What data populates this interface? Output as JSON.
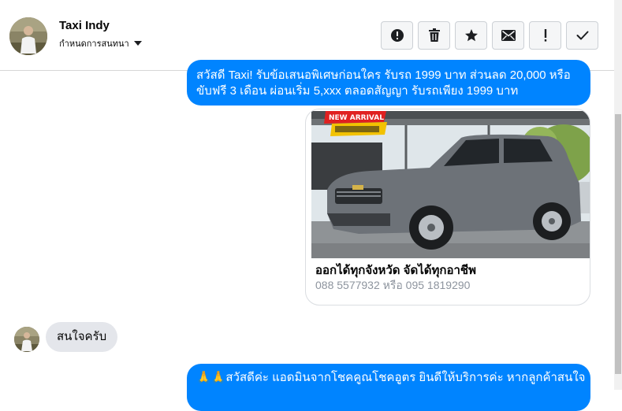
{
  "header": {
    "contact_name": "Taxi Indy",
    "conversation_settings_label": "กำหนดการสนทนา",
    "toolbar": [
      {
        "name": "mark-spam-button",
        "icon": "alert-circle-icon"
      },
      {
        "name": "delete-button",
        "icon": "trash-icon"
      },
      {
        "name": "star-button",
        "icon": "star-icon"
      },
      {
        "name": "mark-unread-button",
        "icon": "envelope-icon"
      },
      {
        "name": "mark-important-button",
        "icon": "exclamation-icon"
      },
      {
        "name": "mark-done-button",
        "icon": "checkmark-icon"
      }
    ]
  },
  "conversation": {
    "messages": [
      {
        "direction": "outgoing",
        "lines": [
          "สวัสดี Taxi! รับข้อเสนอพิเศษก่อนใคร รับรถ 1999 บาท ส่วนลด 20,000 หรือ",
          "ขับฟรี 3 เดือน ผ่อนเริ่ม 5,xxx ตลอดสัญญา รับรถเพียง 1999 บาท"
        ]
      },
      {
        "direction": "outgoing",
        "type": "attachment",
        "image_description": "grey pickup truck",
        "badge_text": "NEW ARRIVAL",
        "title": "ออกได้ทุกจังหวัด จัดได้ทุกอาชีพ",
        "subtitle": "088 5577932 หรือ 095 1819290"
      },
      {
        "direction": "incoming",
        "text": "สนใจครับ"
      },
      {
        "direction": "outgoing",
        "emoji": "🙏🙏",
        "text": "สวัสดีค่ะ แอดมินจากโชคคูณโชคอูตร ยินดีให้บริการค่ะ หากลูกค้าสนใจ"
      }
    ]
  },
  "colors": {
    "outgoing_bubble": "#0084ff",
    "incoming_bubble": "#e4e6eb",
    "toolbar_button_bg": "#f5f6f7"
  }
}
